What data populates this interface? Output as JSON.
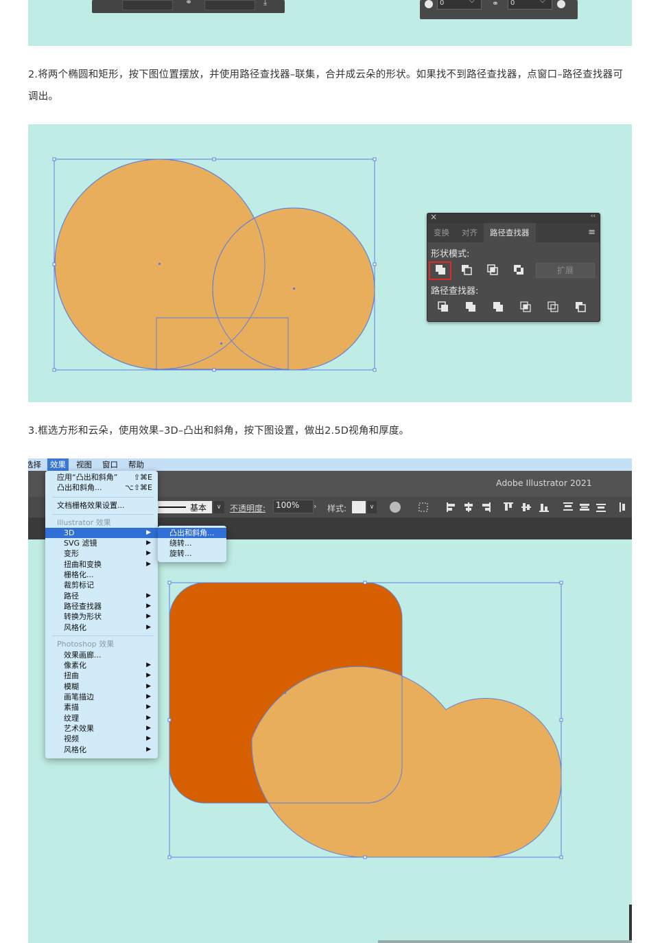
{
  "top_panel": {
    "left_fields": [
      "",
      ""
    ],
    "right_fields": [
      "0",
      "0"
    ]
  },
  "step2": {
    "text": "2.将两个椭圆和矩形，按下图位置摆放，并使用路径查找器–联集，合并成云朵的形状。如果找不到路径查找器，点窗口–路径查找器可调出。"
  },
  "pathfinder_panel": {
    "close_glyph": "×",
    "collapse_glyph": "‹‹",
    "tabs": [
      {
        "label": "变换",
        "active": false
      },
      {
        "label": "对齐",
        "active": false
      },
      {
        "label": "路径查找器",
        "active": true
      }
    ],
    "menu_glyph": "≡",
    "shape_modes_label": "形状模式:",
    "expand_label": "扩展",
    "pathfinders_label": "路径查找器:",
    "highlight_color": "#e02b2b"
  },
  "step3": {
    "text": "3.框选方形和云朵，使用效果–3D–凸出和斜角，按下图设置，做出2.5D视角和厚度。"
  },
  "illustrator": {
    "menubar": [
      "选择",
      "效果",
      "视图",
      "窗口",
      "帮助"
    ],
    "active_menu": "效果",
    "app_title": "Adobe Illustrator 2021",
    "stroke_profile": "基本",
    "opacity_label": "不透明度:",
    "opacity_value": "100%",
    "style_label": "样式:",
    "effect_menu": {
      "recent": [
        {
          "label": "应用“凸出和斜角”",
          "shortcut": "⇧⌘E"
        },
        {
          "label": "凸出和斜角...",
          "shortcut": "⌥⇧⌘E"
        }
      ],
      "doc_raster": "文档栅格效果设置...",
      "illustrator_group": "Illustrator 效果",
      "illustrator_items": [
        {
          "label": "3D",
          "sub": true,
          "selected": true
        },
        {
          "label": "SVG 滤镜",
          "sub": true
        },
        {
          "label": "变形",
          "sub": true
        },
        {
          "label": "扭曲和变换",
          "sub": true
        },
        {
          "label": "栅格化...",
          "sub": false
        },
        {
          "label": "裁剪标记",
          "sub": false
        },
        {
          "label": "路径",
          "sub": true
        },
        {
          "label": "路径查找器",
          "sub": true
        },
        {
          "label": "转换为形状",
          "sub": true
        },
        {
          "label": "风格化",
          "sub": true
        }
      ],
      "photoshop_group": "Photoshop 效果",
      "photoshop_items": [
        {
          "label": "效果画廊...",
          "sub": false
        },
        {
          "label": "像素化",
          "sub": true
        },
        {
          "label": "扭曲",
          "sub": true
        },
        {
          "label": "模糊",
          "sub": true
        },
        {
          "label": "画笔描边",
          "sub": true
        },
        {
          "label": "素描",
          "sub": true
        },
        {
          "label": "纹理",
          "sub": true
        },
        {
          "label": "艺术效果",
          "sub": true
        },
        {
          "label": "视频",
          "sub": true
        },
        {
          "label": "风格化",
          "sub": true
        }
      ],
      "submenu_3d": [
        {
          "label": "凸出和斜角...",
          "selected": true
        },
        {
          "label": "绕转...",
          "selected": false
        },
        {
          "label": "旋转...",
          "selected": false
        }
      ]
    }
  },
  "colors": {
    "panel_bg": "#bfece4",
    "shape_fill": "#e8ae5c",
    "square_fill": "#d66000",
    "selection": "#5b7fe0"
  }
}
